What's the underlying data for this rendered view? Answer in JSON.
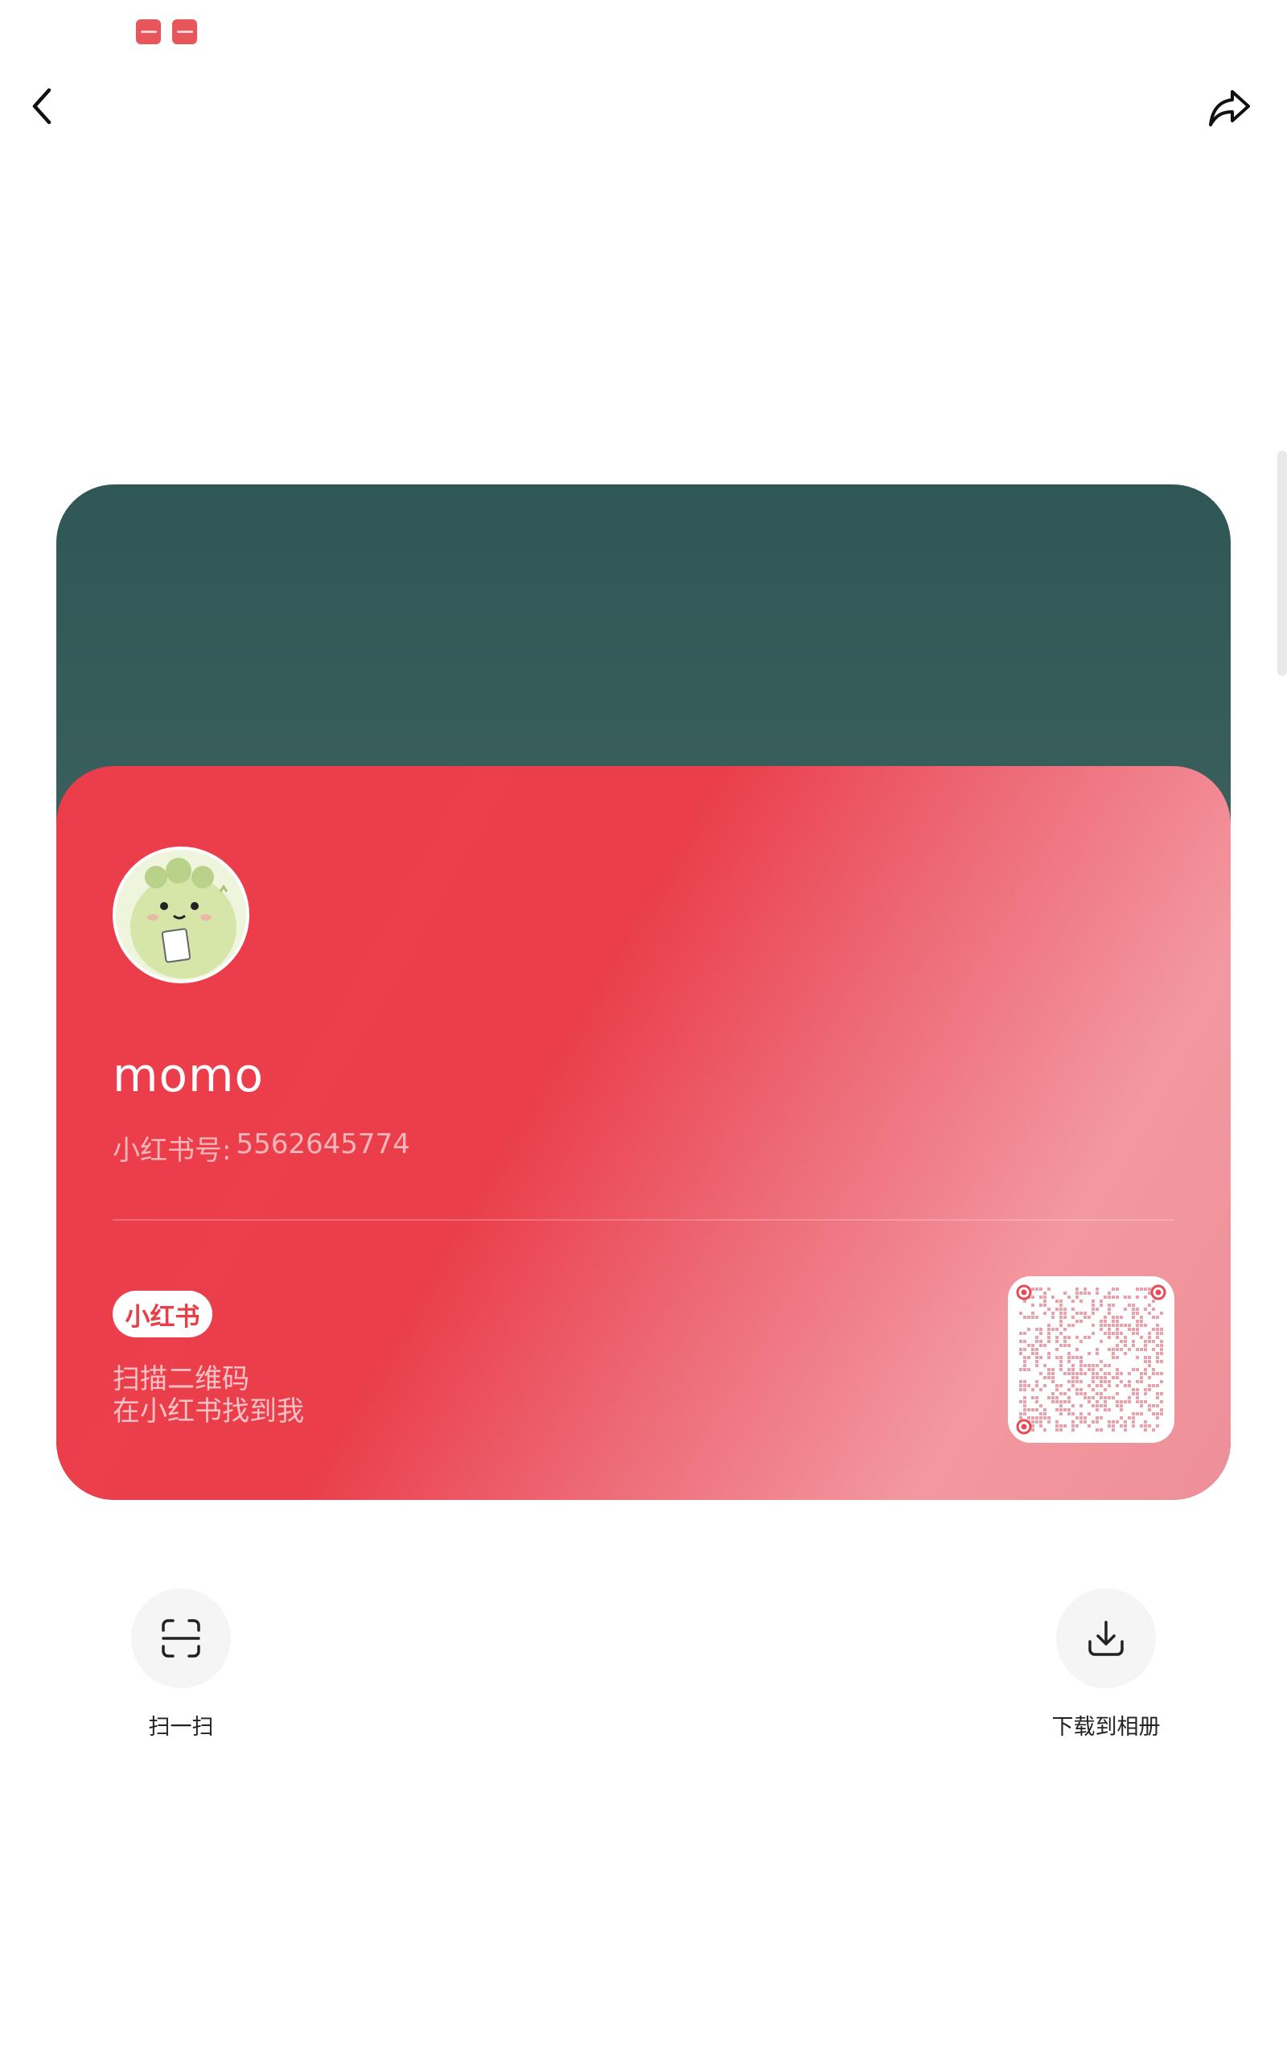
{
  "status_bar": {
    "icons": [
      "app-notification-icon",
      "app-notification-icon"
    ]
  },
  "top_bar": {
    "back_icon": "chevron-left-icon",
    "share_icon": "share-icon"
  },
  "card": {
    "username": "momo",
    "id_label": "小红书号:",
    "id_value": "5562645774",
    "brand": "小红书",
    "scan_hint_line1": "扫描二维码",
    "scan_hint_line2": "在小红书找到我",
    "colors": {
      "accent_red": "#ec3e4a",
      "header_teal": "#3e625f"
    }
  },
  "actions": {
    "scan_label": "扫一扫",
    "download_label": "下载到相册"
  }
}
